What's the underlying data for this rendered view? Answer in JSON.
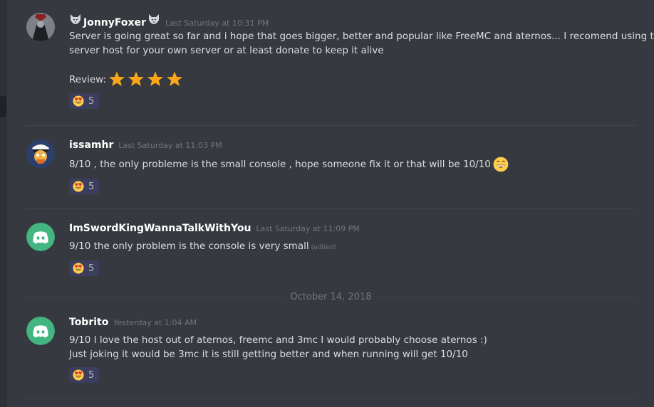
{
  "colors": {
    "background": "#36393f",
    "username": "#ffffff",
    "timestamp": "#72767d",
    "reaction_bg": "#3b3e5c",
    "discord_green": "#43b581",
    "star": "#faa61a"
  },
  "messages": [
    {
      "username": "JonnyFoxer",
      "name_icon": "wolf-icon",
      "timestamp": "Last Saturday at 10:31 PM",
      "lines": [
        "Server is going great so far and i hope that goes bigger, better and popular like FreeMC and aternos... I recomend using this",
        "server host for your own server or at least donate to keep it alive"
      ],
      "review_label": "Review:",
      "review_stars": 4,
      "reaction": {
        "emoji": "heart-eyes-emoji",
        "count": "5"
      }
    },
    {
      "username": "issamhr",
      "timestamp": "Last Saturday at 11:03 PM",
      "lines": [
        "8/10 , the only probleme is the small console , hope someone fix it or that will be 10/10"
      ],
      "inline_emoji": "grinning-emoji",
      "reaction": {
        "emoji": "heart-eyes-emoji",
        "count": "5"
      }
    },
    {
      "username": "ImSwordKingWannaTalkWithYou",
      "timestamp": "Last Saturday at 11:09 PM",
      "lines": [
        "9/10 the only problem is the console is very small"
      ],
      "edited": "(edited)",
      "reaction": {
        "emoji": "heart-eyes-emoji",
        "count": "5"
      }
    },
    {
      "username": "Tobrito",
      "timestamp": "Yesterday at 1:04 AM",
      "lines": [
        "9/10 I love the host out of aternos, freemc and 3mc I would probably choose aternos :)",
        "Just joking it would be 3mc it is still getting better and when running will get 10/10"
      ],
      "reaction": {
        "emoji": "heart-eyes-emoji",
        "count": "5"
      }
    }
  ],
  "date_divider": "October 14, 2018"
}
